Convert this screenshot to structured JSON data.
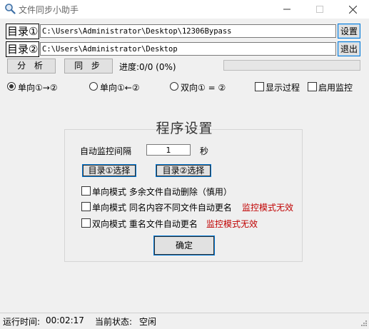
{
  "window": {
    "title": "文件同步小助手",
    "icon": "magnifier-icon",
    "controls": [
      "minimize",
      "maximize",
      "close"
    ]
  },
  "dir1": {
    "label": "目录①",
    "path": "C:\\Users\\Administrator\\Desktop\\12306Bypass",
    "button": "设置"
  },
  "dir2": {
    "label": "目录②",
    "path": "C:\\Users\\Administrator\\Desktop",
    "button": "退出"
  },
  "actions": {
    "analyze": "分 析",
    "sync": "同 步",
    "progress_label": "进度:0/0 (0%)",
    "progress_fraction": 0
  },
  "modes": {
    "options": [
      {
        "label": "单向①→②",
        "selected": true
      },
      {
        "label": "单向①←②",
        "selected": false
      },
      {
        "label": "双向① = ②",
        "selected": false
      }
    ],
    "show_process": {
      "label": "显示过程",
      "checked": false
    },
    "enable_monitor": {
      "label": "启用监控",
      "checked": false
    }
  },
  "settings": {
    "title": "程序设置",
    "interval_label": "自动监控间隔",
    "interval_value": "1",
    "interval_unit": "秒",
    "select_dir1": "目录①选择",
    "select_dir2": "目录②选择",
    "opt1": "单向模式 多余文件自动删除（慎用）",
    "opt2": "单向模式 同名内容不同文件自动更名",
    "opt2_note": "监控模式无效",
    "opt3": "双向模式 重名文件自动更名",
    "opt3_note": "监控模式无效",
    "confirm": "确定"
  },
  "status": {
    "runtime_label": "运行时间:",
    "runtime_value": "00:02:17",
    "state_label": "当前状态:",
    "state_value": "空闲"
  },
  "colors": {
    "accent": "#0078d7",
    "warning_text": "#c00000",
    "background": "#f0f0f0"
  }
}
